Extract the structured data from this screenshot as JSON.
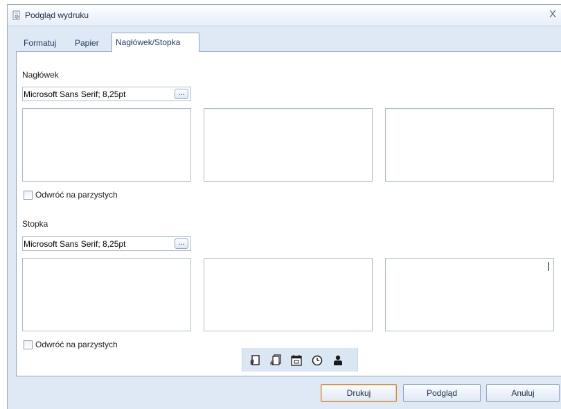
{
  "window": {
    "title": "Podgląd wydruku",
    "close_label": "X"
  },
  "tabs": [
    {
      "label": "Formatuj",
      "active": false
    },
    {
      "label": "Papier",
      "active": false
    },
    {
      "label": "Nagłówek/Stopka",
      "active": true
    }
  ],
  "header_section": {
    "label": "Nagłówek",
    "font_value": "Microsoft Sans Serif; 8,25pt",
    "font_button_label": "...",
    "checkbox_label": "Odwróć na parzystych",
    "checkbox_checked": false
  },
  "footer_section": {
    "label": "Stopka",
    "font_value": "Microsoft Sans Serif; 8,25pt",
    "font_button_label": "...",
    "checkbox_label": "Odwróć na parzystych",
    "checkbox_checked": false
  },
  "insert_toolbar": {
    "icons": [
      "page-number-icon",
      "page-count-icon",
      "date-icon",
      "time-icon",
      "user-icon"
    ]
  },
  "buttons": {
    "print": "Drukuj",
    "preview": "Podgląd",
    "cancel": "Anuluj"
  },
  "colors": {
    "window_bg": "#dfe9f5",
    "panel_bg": "#ffffff",
    "border": "#8ea7c8",
    "primary_button_border": "#d3893b"
  }
}
